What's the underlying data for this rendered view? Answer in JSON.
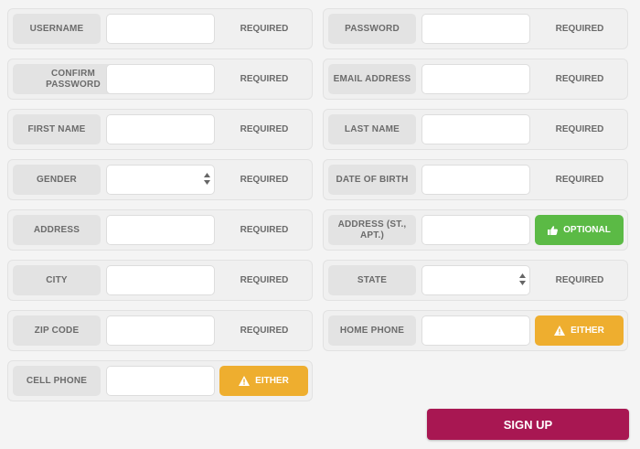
{
  "form": {
    "fields": [
      {
        "key": "username",
        "label": "USERNAME",
        "status": "REQUIRED"
      },
      {
        "key": "password",
        "label": "PASSWORD",
        "status": "REQUIRED"
      },
      {
        "key": "confirm_password",
        "label": "CONFIRM PASSWORD",
        "status": "REQUIRED"
      },
      {
        "key": "email",
        "label": "EMAIL ADDRESS",
        "status": "REQUIRED"
      },
      {
        "key": "first_name",
        "label": "FIRST NAME",
        "status": "REQUIRED"
      },
      {
        "key": "last_name",
        "label": "LAST NAME",
        "status": "REQUIRED"
      },
      {
        "key": "gender",
        "label": "GENDER",
        "status": "REQUIRED"
      },
      {
        "key": "dob",
        "label": "DATE OF BIRTH",
        "status": "REQUIRED"
      },
      {
        "key": "address",
        "label": "ADDRESS",
        "status": "REQUIRED"
      },
      {
        "key": "address2",
        "label": "ADDRESS (ST., APT.)",
        "status": "OPTIONAL"
      },
      {
        "key": "city",
        "label": "CITY",
        "status": "REQUIRED"
      },
      {
        "key": "state",
        "label": "STATE",
        "status": "REQUIRED"
      },
      {
        "key": "zip",
        "label": "ZIP CODE",
        "status": "REQUIRED"
      },
      {
        "key": "home_phone",
        "label": "HOME PHONE",
        "status": "EITHER"
      },
      {
        "key": "cell_phone",
        "label": "CELL PHONE",
        "status": "EITHER"
      }
    ],
    "submit_label": "SIGN UP"
  },
  "colors": {
    "optional": "#5bba45",
    "either": "#eeae2f",
    "submit": "#a81752"
  },
  "icons": {
    "optional": "thumbs-up-icon",
    "either": "warning-icon",
    "select": "up-down-arrows-icon"
  }
}
